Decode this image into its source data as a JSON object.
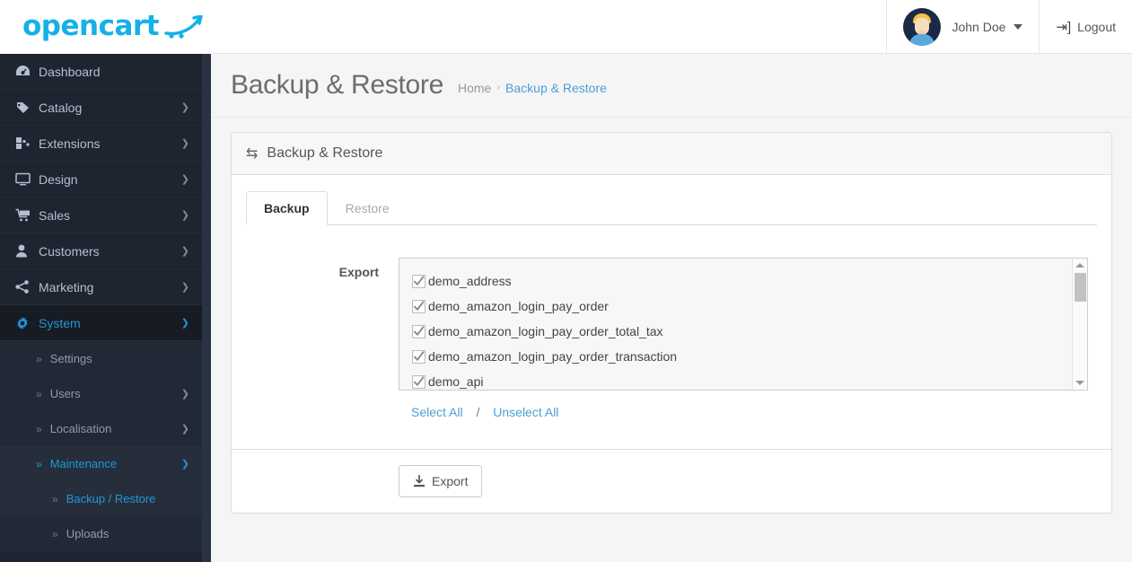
{
  "brand": {
    "name": "opencart",
    "color": "#16b0e8",
    "cart_icon": "shopping-cart-swoosh-icon"
  },
  "topbar": {
    "user_name": "John Doe",
    "logout_label": "Logout",
    "logout_icon": "logout-icon",
    "avatar_icon": "user-avatar"
  },
  "sidebar": {
    "items": [
      {
        "label": "Dashboard",
        "icon": "dashboard-icon",
        "has_arrow": false,
        "active": false
      },
      {
        "label": "Catalog",
        "icon": "tag-icon",
        "has_arrow": true,
        "active": false
      },
      {
        "label": "Extensions",
        "icon": "puzzle-icon",
        "has_arrow": true,
        "active": false
      },
      {
        "label": "Design",
        "icon": "monitor-icon",
        "has_arrow": true,
        "active": false
      },
      {
        "label": "Sales",
        "icon": "shopping-cart-icon",
        "has_arrow": true,
        "active": false
      },
      {
        "label": "Customers",
        "icon": "user-icon",
        "has_arrow": true,
        "active": false
      },
      {
        "label": "Marketing",
        "icon": "share-icon",
        "has_arrow": true,
        "active": false
      },
      {
        "label": "System",
        "icon": "gear-icon",
        "has_arrow": true,
        "active": true
      }
    ],
    "subitems": [
      {
        "label": "Settings",
        "has_arrow": false,
        "highlight": false
      },
      {
        "label": "Users",
        "has_arrow": true,
        "highlight": false
      },
      {
        "label": "Localisation",
        "has_arrow": true,
        "highlight": false
      },
      {
        "label": "Maintenance",
        "has_arrow": true,
        "highlight": true
      }
    ],
    "level3": [
      {
        "label": "Backup / Restore",
        "highlight": true
      },
      {
        "label": "Uploads",
        "highlight": false
      }
    ]
  },
  "page": {
    "title": "Backup & Restore",
    "breadcrumb": [
      {
        "label": "Home",
        "current": false
      },
      {
        "label": "Backup & Restore",
        "current": true
      }
    ],
    "breadcrumb_separator": "›"
  },
  "card": {
    "header_title": "Backup & Restore",
    "header_icon": "exchange-arrows-icon",
    "tabs": [
      {
        "label": "Backup",
        "active": true
      },
      {
        "label": "Restore",
        "active": false
      }
    ],
    "export_label": "Export",
    "tables": [
      {
        "name": "demo_address",
        "checked": true
      },
      {
        "name": "demo_amazon_login_pay_order",
        "checked": true
      },
      {
        "name": "demo_amazon_login_pay_order_total_tax",
        "checked": true
      },
      {
        "name": "demo_amazon_login_pay_order_transaction",
        "checked": true
      },
      {
        "name": "demo_api",
        "checked": true
      }
    ],
    "select_all_label": "Select All",
    "separator": "/",
    "unselect_all_label": "Unselect All",
    "export_button_label": "Export",
    "export_button_icon": "download-icon",
    "scrollbar": {
      "up_icon": "scroll-up-arrow-icon",
      "down_icon": "scroll-down-arrow-icon",
      "thumb": "scrollbar-thumb"
    }
  },
  "colors": {
    "brand_cyan": "#16b0e8",
    "link_blue": "#4e9fd4",
    "sidebar_bg": "#1e2430",
    "sidebar_outer": "#2a3344",
    "page_bg": "#f5f5f5"
  }
}
